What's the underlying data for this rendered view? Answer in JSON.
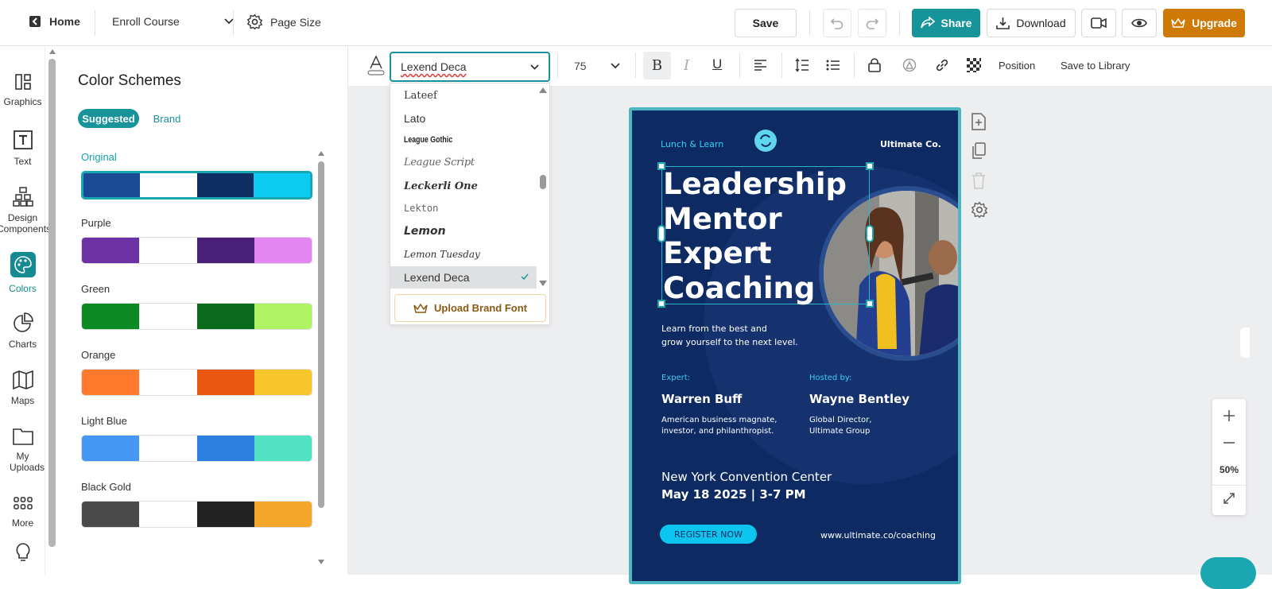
{
  "topbar": {
    "home_label": "Home",
    "course_label": "Enroll Course",
    "page_size_label": "Page Size",
    "save_label": "Save",
    "share_label": "Share",
    "download_label": "Download",
    "upgrade_label": "Upgrade"
  },
  "sidebar": {
    "items": [
      {
        "label": "Graphics",
        "icon": "graphics-icon"
      },
      {
        "label": "Text",
        "icon": "text-icon"
      },
      {
        "label": "Design Components",
        "icon": "components-icon"
      },
      {
        "label": "Colors",
        "icon": "palette-icon"
      },
      {
        "label": "Charts",
        "icon": "pie-chart-icon"
      },
      {
        "label": "Maps",
        "icon": "map-icon"
      },
      {
        "label": "My Uploads",
        "icon": "folder-icon"
      },
      {
        "label": "More",
        "icon": "grid-icon"
      }
    ]
  },
  "panel": {
    "title": "Color Schemes",
    "tab_suggested": "Suggested",
    "tab_brand": "Brand",
    "schemes": [
      {
        "name": "Original",
        "colors": [
          "#1a4a94",
          "#ffffff",
          "#0f2f63",
          "#0ccbf0"
        ]
      },
      {
        "name": "Purple",
        "colors": [
          "#6c31a3",
          "#ffffff",
          "#4a1f77",
          "#e486f2"
        ]
      },
      {
        "name": "Green",
        "colors": [
          "#0b8a24",
          "#ffffff",
          "#0b6b1d",
          "#aef363"
        ]
      },
      {
        "name": "Orange",
        "colors": [
          "#ff7a2c",
          "#ffffff",
          "#e8560f",
          "#f6c62a"
        ]
      },
      {
        "name": "Light Blue",
        "colors": [
          "#4497f3",
          "#ffffff",
          "#2d7fe0",
          "#50e2c3"
        ]
      },
      {
        "name": "Black Gold",
        "colors": [
          "#4a4a4a",
          "#ffffff",
          "#222222",
          "#f4a72a"
        ]
      }
    ]
  },
  "toolbar": {
    "font_value": "Lexend Deca",
    "font_size": "75",
    "position_label": "Position",
    "save_library_label": "Save to Library"
  },
  "font_dropdown": {
    "items": [
      "Lateef",
      "Lato",
      "League Gothic",
      "League Script",
      "Leckerli One",
      "Lekton",
      "Lemon",
      "Lemon Tuesday",
      "Lexend Deca"
    ],
    "selected": "Lexend Deca",
    "upload_label": "Upload Brand Font"
  },
  "poster": {
    "tag": "Lunch & Learn",
    "brand": "Ultimate Co.",
    "heading": [
      "Leadership",
      "Mentor",
      "Expert",
      "Coaching"
    ],
    "subtitle": [
      "Learn from the best and",
      "grow yourself to the next level."
    ],
    "expert_label": "Expert:",
    "expert_name": "Warren Buff",
    "expert_desc": [
      "American business magnate,",
      "investor, and philanthropist."
    ],
    "host_label": "Hosted by:",
    "host_name": "Wayne Bentley",
    "host_desc": [
      "Global Director,",
      "Ultimate Group"
    ],
    "venue": "New York Convention Center",
    "date": "May 18 2025 | 3-7 PM",
    "cta": "REGISTER NOW",
    "url": "www.ultimate.co/coaching"
  },
  "zoom": {
    "level": "50%"
  }
}
